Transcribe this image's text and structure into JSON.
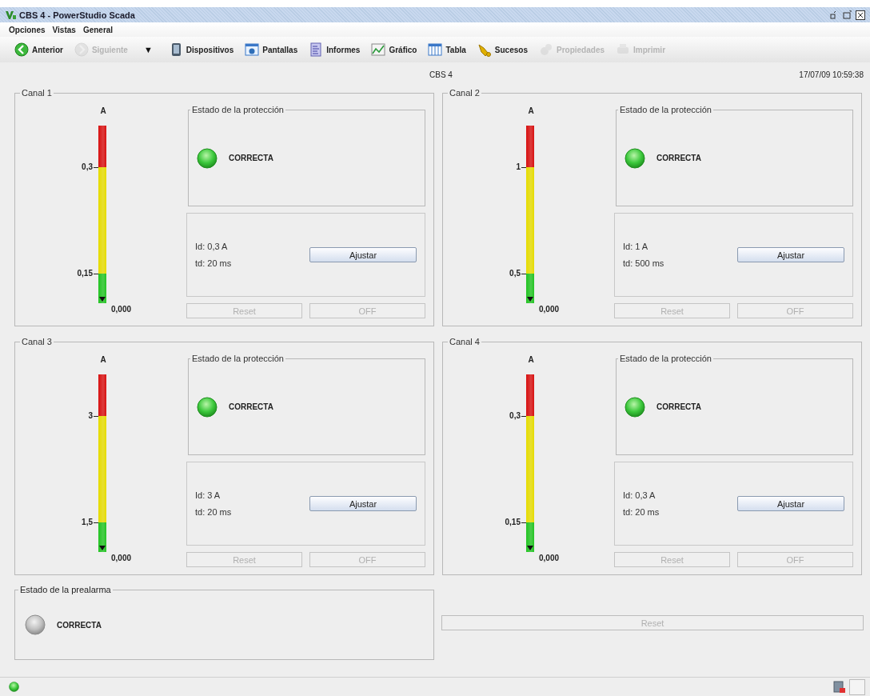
{
  "window": {
    "title": "CBS 4 - PowerStudio Scada"
  },
  "menu": [
    "Opciones",
    "Vistas",
    "General"
  ],
  "toolbar": [
    {
      "label": "Anterior",
      "disabled": false
    },
    {
      "label": "Siguiente",
      "disabled": true
    },
    {
      "label": "▼",
      "kind": "dropdown",
      "disabled": false
    },
    {
      "label": "Dispositivos",
      "disabled": false
    },
    {
      "label": "Pantallas",
      "disabled": false
    },
    {
      "label": "Informes",
      "disabled": false
    },
    {
      "label": "Gráfico",
      "disabled": false
    },
    {
      "label": "Tabla",
      "disabled": false
    },
    {
      "label": "Sucesos",
      "disabled": false
    },
    {
      "label": "Propiedades",
      "disabled": true
    },
    {
      "label": "Imprimir",
      "disabled": true
    }
  ],
  "header": {
    "title": "CBS 4",
    "datetime": "17/07/09 10:59:38"
  },
  "channels": [
    {
      "title": "Canal 1",
      "gauge": {
        "unit": "A",
        "ticks": [
          "0,3",
          "0,15"
        ],
        "reading": "0,000",
        "level": 0
      },
      "protection": {
        "title": "Estado de la protección",
        "on": true,
        "status": "CORRECTA"
      },
      "id": "Id: 0,3 A",
      "td": "td: 20 ms",
      "adjust": "Ajustar",
      "reset": {
        "label": "Reset",
        "disabled": true
      },
      "off": {
        "label": "OFF",
        "disabled": true
      }
    },
    {
      "title": "Canal 2",
      "gauge": {
        "unit": "A",
        "ticks": [
          "1",
          "0,5"
        ],
        "reading": "0,000",
        "level": 0
      },
      "protection": {
        "title": "Estado de la protección",
        "on": true,
        "status": "CORRECTA"
      },
      "id": "Id: 1 A",
      "td": "td: 500 ms",
      "adjust": "Ajustar",
      "reset": {
        "label": "Reset",
        "disabled": true
      },
      "off": {
        "label": "OFF",
        "disabled": true
      }
    },
    {
      "title": "Canal 3",
      "gauge": {
        "unit": "A",
        "ticks": [
          "3",
          "1,5"
        ],
        "reading": "0,000",
        "level": 0
      },
      "protection": {
        "title": "Estado de la protección",
        "on": true,
        "status": "CORRECTA"
      },
      "id": "Id: 3 A",
      "td": "td: 20 ms",
      "adjust": "Ajustar",
      "reset": {
        "label": "Reset",
        "disabled": true
      },
      "off": {
        "label": "OFF",
        "disabled": true
      }
    },
    {
      "title": "Canal 4",
      "gauge": {
        "unit": "A",
        "ticks": [
          "0,3",
          "0,15"
        ],
        "reading": "0,000",
        "level": 0
      },
      "protection": {
        "title": "Estado de la protección",
        "on": true,
        "status": "CORRECTA"
      },
      "id": "Id: 0,3 A",
      "td": "td: 20 ms",
      "adjust": "Ajustar",
      "reset": {
        "label": "Reset",
        "disabled": true
      },
      "off": {
        "label": "OFF",
        "disabled": true
      }
    }
  ],
  "prealarm": {
    "title": "Estado de la prealarma",
    "on": false,
    "status": "CORRECTA"
  },
  "reset_all": {
    "label": "Reset",
    "disabled": true
  },
  "status_bar": {
    "connected": true
  }
}
